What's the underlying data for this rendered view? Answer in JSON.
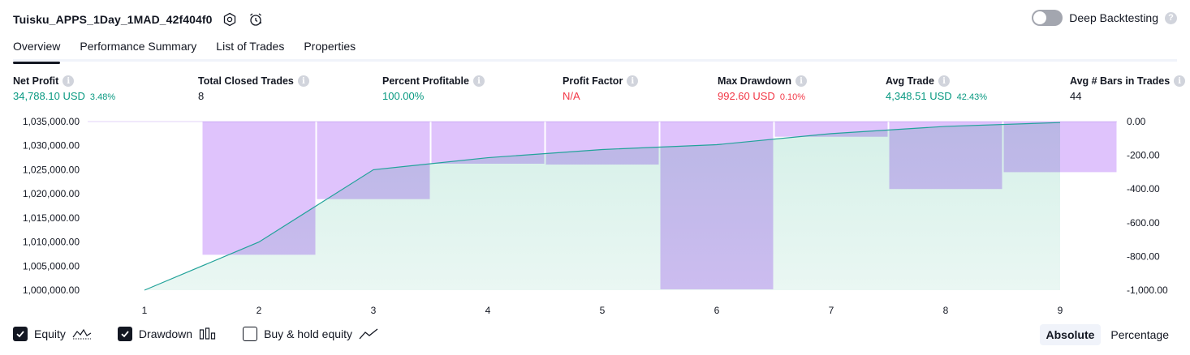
{
  "header": {
    "strategy_name": "Tuisku_APPS_1Day_1MAD_42f404f0",
    "deep_backtesting_label": "Deep Backtesting",
    "deep_backtesting_enabled": false
  },
  "tabs": [
    {
      "label": "Overview",
      "active": true
    },
    {
      "label": "Performance Summary",
      "active": false
    },
    {
      "label": "List of Trades",
      "active": false
    },
    {
      "label": "Properties",
      "active": false
    }
  ],
  "metrics": [
    {
      "label": "Net Profit",
      "value": "34,788.10 USD",
      "sub": "3.48%",
      "color": "green"
    },
    {
      "label": "Total Closed Trades",
      "value": "8",
      "sub": "",
      "color": "dark"
    },
    {
      "label": "Percent Profitable",
      "value": "100.00%",
      "sub": "",
      "color": "green"
    },
    {
      "label": "Profit Factor",
      "value": "N/A",
      "sub": "",
      "color": "red"
    },
    {
      "label": "Max Drawdown",
      "value": "992.60 USD",
      "sub": "0.10%",
      "color": "red"
    },
    {
      "label": "Avg Trade",
      "value": "4,348.51 USD",
      "sub": "42.43%",
      "color": "green"
    },
    {
      "label": "Avg # Bars in Trades",
      "value": "44",
      "sub": "",
      "color": "dark"
    }
  ],
  "chart_data": {
    "type": "line",
    "x": [
      1,
      2,
      3,
      4,
      5,
      6,
      7,
      8,
      9
    ],
    "series": [
      {
        "name": "Equity",
        "axis": "left",
        "values": [
          1000000,
          1010000,
          1025000,
          1027500,
          1029200,
          1030200,
          1032500,
          1034000,
          1034800
        ]
      },
      {
        "name": "Drawdown",
        "type": "bar",
        "axis": "right",
        "values": [
          0,
          -790,
          -460,
          -250,
          -255,
          -995,
          -90,
          -400,
          -300
        ]
      }
    ],
    "left_axis": {
      "ticks": [
        "1,035,000.00",
        "1,030,000.00",
        "1,025,000.00",
        "1,020,000.00",
        "1,015,000.00",
        "1,010,000.00",
        "1,005,000.00",
        "1,000,000.00"
      ],
      "ylim": [
        1000000,
        1035000
      ]
    },
    "right_axis": {
      "ticks": [
        "0.00",
        "-200.00",
        "-400.00",
        "-600.00",
        "-800.00",
        "-1,000.00"
      ],
      "ylim": [
        -1000,
        0
      ]
    },
    "x_ticks": [
      "1",
      "2",
      "3",
      "4",
      "5",
      "6",
      "7",
      "8",
      "9"
    ],
    "colors": {
      "equity_line": "#22a39a",
      "equity_fill": "#d5f0e8",
      "drawdown_bar": "#d9b8fb",
      "drawdown_overlap": "#aab8e0"
    }
  },
  "legend": [
    {
      "label": "Equity",
      "checked": true,
      "icon": "equity-wave-icon"
    },
    {
      "label": "Drawdown",
      "checked": true,
      "icon": "drawdown-bars-icon"
    },
    {
      "label": "Buy & hold equity",
      "checked": false,
      "icon": "buy-hold-line-icon"
    }
  ],
  "mode": {
    "absolute_label": "Absolute",
    "percentage_label": "Percentage",
    "selected": "Absolute"
  }
}
